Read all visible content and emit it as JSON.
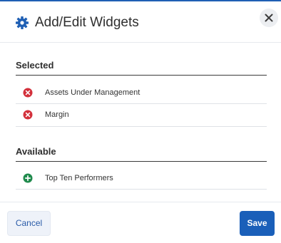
{
  "dialog": {
    "title": "Add/Edit Widgets",
    "title_icon": "gear-icon",
    "close_icon": "close-icon"
  },
  "selected": {
    "label": "Selected",
    "items": [
      {
        "label": "Assets Under Management",
        "icon": "remove-circle-icon",
        "color": "#d3303b"
      },
      {
        "label": "Margin",
        "icon": "remove-circle-icon",
        "color": "#d3303b"
      }
    ]
  },
  "available": {
    "label": "Available",
    "items": [
      {
        "label": "Top Ten Performers",
        "icon": "add-circle-icon",
        "color": "#1f8a4c"
      }
    ]
  },
  "footer": {
    "cancel_label": "Cancel",
    "save_label": "Save"
  },
  "colors": {
    "accent": "#1a5fb9",
    "remove": "#d3303b",
    "add": "#1f8a4c"
  }
}
